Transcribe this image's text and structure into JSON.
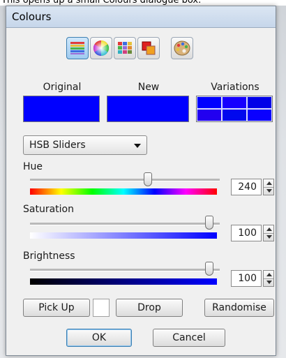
{
  "caption": "This opens up a small Colours dialogue box.",
  "dialog": {
    "title": "Colours"
  },
  "mode_buttons": [
    {
      "icon": "sliders-icon",
      "active": true
    },
    {
      "icon": "color-wheel-icon",
      "active": false
    },
    {
      "icon": "swatch-grid-icon",
      "active": false
    },
    {
      "icon": "color-layers-icon",
      "active": false
    },
    {
      "icon": "palette-icon",
      "active": false
    }
  ],
  "preview": {
    "original_label": "Original",
    "new_label": "New",
    "variations_label": "Variations",
    "original_color": "#0000ff",
    "new_color": "#0000ff"
  },
  "mode_select": {
    "value": "HSB Sliders"
  },
  "sliders": {
    "hue": {
      "label": "Hue",
      "value": "240",
      "fraction": 0.667
    },
    "saturation": {
      "label": "Saturation",
      "value": "100",
      "fraction": 1.0
    },
    "brightness": {
      "label": "Brightness",
      "value": "100",
      "fraction": 1.0
    }
  },
  "actions": {
    "pick_up": "Pick Up",
    "drop": "Drop",
    "randomise": "Randomise",
    "ok": "OK",
    "cancel": "Cancel"
  }
}
